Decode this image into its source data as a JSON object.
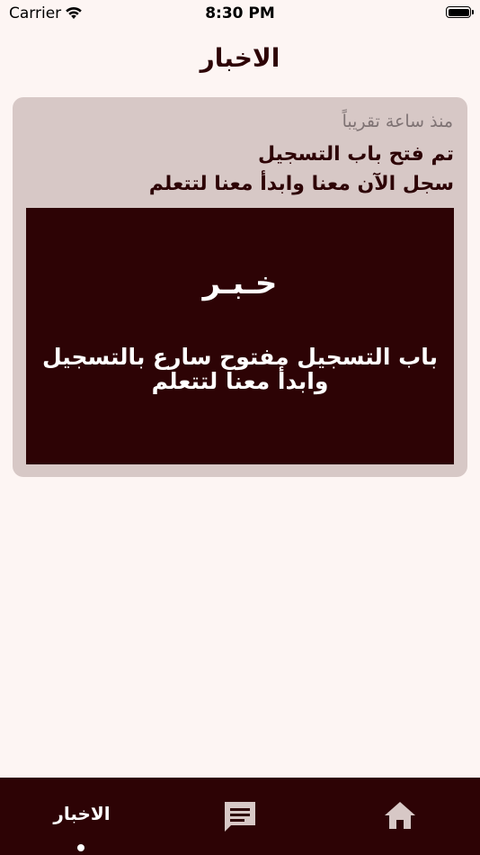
{
  "status_bar": {
    "carrier": "Carrier",
    "time": "8:30 PM"
  },
  "header": {
    "title": "الاخبار"
  },
  "news_card": {
    "time": "منذ ساعة تقريباً",
    "title": "تم فتح باب التسجيل",
    "subtitle": "سجل الآن معنا وابدأ معنا لتتعلم",
    "image": {
      "heading": "خـبـر",
      "body": "باب التسجيل مفتوح سارع بالتسجيل وابدأ معنا لتتعلم"
    }
  },
  "tab_bar": {
    "tabs": [
      {
        "label": "الاخبار",
        "icon": "news",
        "selected": true
      },
      {
        "icon": "chat-icon",
        "selected": false
      },
      {
        "icon": "home-icon",
        "selected": false
      }
    ]
  },
  "colors": {
    "background": "#fdf5f3",
    "primary": "#2d0305",
    "card": "#d7c8c6",
    "muted_text": "#7f7374"
  }
}
